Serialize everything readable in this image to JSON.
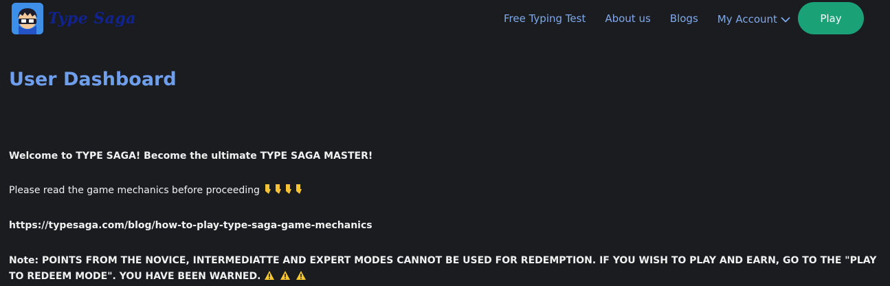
{
  "brand": {
    "name": "Type Saga",
    "logo_icon": "ninja-mascot-icon",
    "color": "#10238f"
  },
  "nav": {
    "links": [
      "Free Typing Test",
      "About us",
      "Blogs"
    ],
    "account_label": "My Account",
    "play_label": "Play"
  },
  "main": {
    "title": "User Dashboard",
    "welcome": "Welcome to TYPE SAGA! Become the ultimate TYPE SAGA MASTER!",
    "read_text": "Please read the game mechanics before proceeding",
    "read_emoji_icons": [
      "pointing-down-hand-icon",
      "pointing-down-hand-icon",
      "pointing-down-hand-icon",
      "pointing-down-hand-icon"
    ],
    "url": "https://typesaga.com/blog/how-to-play-type-saga-game-mechanics",
    "note": "Note: POINTS FROM THE NOVICE, INTERMEDIATTE AND EXPERT MODES CANNOT BE USED FOR REDEMPTION. IF YOU WISH TO PLAY AND EARN, GO TO THE \"PLAY TO REDEEM MODE\". YOU HAVE BEEN WARNED.",
    "warning_emoji_icons": [
      "warning-icon",
      "warning-icon",
      "warning-icon"
    ]
  },
  "colors": {
    "background": "#1a1c1f",
    "link": "#7fa9ec",
    "title": "#6f9fec",
    "play_button": "#1ba176"
  }
}
